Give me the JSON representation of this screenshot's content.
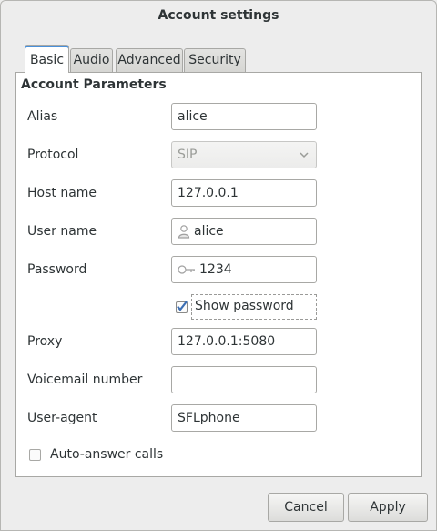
{
  "window": {
    "title": "Account settings"
  },
  "tabs": [
    {
      "label": "Basic",
      "active": true
    },
    {
      "label": "Audio",
      "active": false
    },
    {
      "label": "Advanced",
      "active": false
    },
    {
      "label": "Security",
      "active": false
    }
  ],
  "section": {
    "title": "Account Parameters"
  },
  "fields": {
    "alias": {
      "label": "Alias",
      "value": "alice"
    },
    "protocol": {
      "label": "Protocol",
      "value": "SIP"
    },
    "hostname": {
      "label": "Host name",
      "value": "127.0.0.1"
    },
    "username": {
      "label": "User name",
      "value": "alice",
      "icon": "person-icon"
    },
    "password": {
      "label": "Password",
      "value": "1234",
      "icon": "key-icon"
    },
    "show_password": {
      "label": "Show password",
      "checked": true
    },
    "proxy": {
      "label": "Proxy",
      "value": "127.0.0.1:5080"
    },
    "voicemail": {
      "label": "Voicemail number",
      "value": ""
    },
    "useragent": {
      "label": "User-agent",
      "value": "SFLphone"
    },
    "auto_answer": {
      "label": "Auto-answer calls",
      "checked": false
    }
  },
  "buttons": {
    "cancel": "Cancel",
    "apply": "Apply"
  },
  "colors": {
    "accent": "#4a90d9",
    "background": "#ededed",
    "panel": "#ffffff",
    "border": "#a8a8a5"
  }
}
